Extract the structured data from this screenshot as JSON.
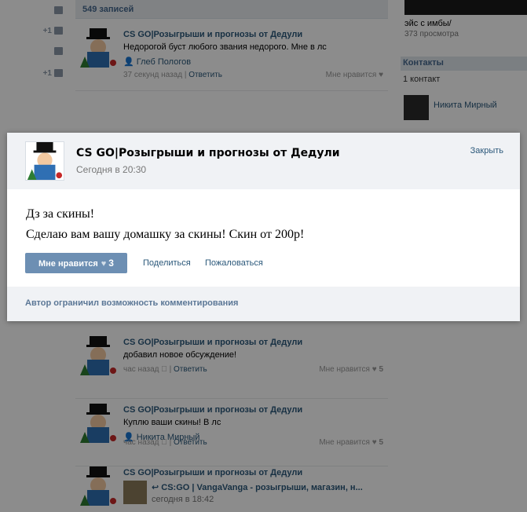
{
  "wall": {
    "count_label": "549 записей",
    "author": "CS GO|Розыгрыши и прогнозы от Дедули",
    "posts": [
      {
        "text": "Недорогой буст любого звания недорого. Мне в лс",
        "signer": "Глеб Пологов",
        "time": "37 секунд назад",
        "reply": "Ответить",
        "like_label": "Мне нравится",
        "like_count": ""
      },
      {
        "text": "добавил новое обсуждение!",
        "time": "час назад",
        "reply": "Ответить",
        "like_label": "Мне нравится",
        "like_count": "5"
      },
      {
        "text": "Куплю ваши скины! В лс",
        "signer": "Никита Мирный",
        "time": "час назад",
        "reply": "Ответить",
        "like_label": "Мне нравится",
        "like_count": "5"
      },
      {
        "repost_title": "CS:GO | VangaVanga - розыгрыши, магазин, н...",
        "repost_date": "сегодня в 18:42"
      }
    ]
  },
  "left_rail": {
    "badge1": "+1",
    "badge2": "+1"
  },
  "right": {
    "video_title": "эйс с имбы/",
    "video_views": "373 просмотра",
    "contacts_title": "Контакты",
    "contacts_count": "1 контакт",
    "contact_name": "Никита Мирный"
  },
  "modal": {
    "author": "CS GO|Розыгрыши и прогнозы от Дедули",
    "date": "Сегодня в 20:30",
    "close": "Закрыть",
    "body_line1": "Дз за скины!",
    "body_line2": "Сделаю вам вашу домашку за скины! Скин от 200р!",
    "like_label": "Мне нравится",
    "like_count": "3",
    "share": "Поделиться",
    "report": "Пожаловаться",
    "comments_notice": "Автор ограничил возможность комментирования"
  }
}
